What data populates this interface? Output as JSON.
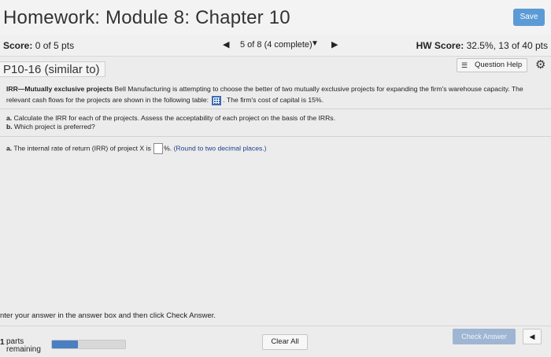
{
  "header": {
    "title": "Homework: Module 8: Chapter 10",
    "save_label": "Save"
  },
  "score_bar": {
    "score_label": "Score:",
    "score_value": "0 of 5 pts",
    "prev_icon": "triangle-left-icon",
    "progress": "5 of 8 (4 complete)",
    "dropdown_icon": "caret-down-icon",
    "next_icon": "triangle-right-icon",
    "hw_score_label": "HW Score:",
    "hw_score_value": "32.5%, 13 of 40 pts"
  },
  "question": {
    "id": "P10-16 (similar to)",
    "help_label": "Question Help",
    "help_icon": "list-icon",
    "settings_icon": "gear-icon"
  },
  "problem": {
    "title": "IRR—Mutually exclusive projects",
    "text_1": "Bell Manufacturing is attempting to choose the better of two mutually exclusive projects for expanding the firm's warehouse capacity. The relevant cash flows for the projects are shown in the following table:",
    "text_2": ". The firm's cost of capital is 15%.",
    "table_icon": "table-grid-icon"
  },
  "tasks": {
    "a_letter": "a.",
    "a_text": "Calculate the IRR for each of the projects. Assess the acceptability of each project on the basis of the IRRs.",
    "b_letter": "b.",
    "b_text": "Which project is preferred?"
  },
  "answer": {
    "letter": "a.",
    "prompt": "The internal rate of return (IRR) of project X is",
    "input_value": "",
    "unit": "%.",
    "note": "(Round to two decimal places.)"
  },
  "footer": {
    "instruction": "nter your answer in the answer box and then click Check Answer.",
    "parts_count": "1",
    "parts_label_1": "parts",
    "parts_label_2": "remaining",
    "parts_progress": 0.35,
    "clear_label": "Clear All",
    "check_label": "Check Answer",
    "back_icon": "triangle-left-icon"
  },
  "colors": {
    "accent": "#5b9bd5",
    "check_disabled": "#9fb6d3",
    "progress_fill": "#4a7fc1",
    "note_blue": "#1f3f88"
  }
}
